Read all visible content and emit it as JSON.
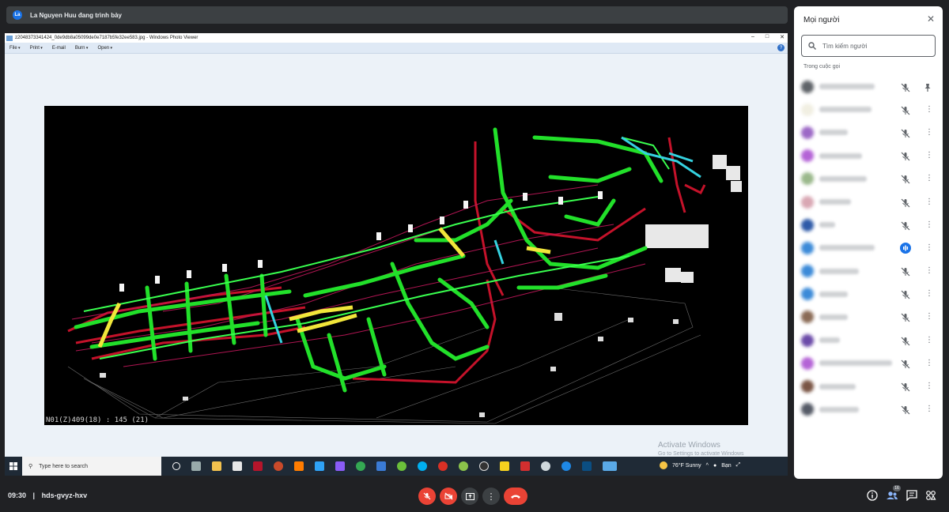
{
  "presenter": {
    "avatar": "La",
    "text": "La Nguyen Huu đang trình bày"
  },
  "shared_screen": {
    "window_title": "z2048373341424_0de9db8a05099de0e7187b5fe32ee583.jpg - Windows Photo Viewer",
    "menu": [
      "File",
      "Print",
      "E-mail",
      "Burn",
      "Open"
    ],
    "image_caption": "N01(Z)409(18) : 145 (21)",
    "activate_line1": "Activate Windows",
    "activate_line2": "Go to Settings to activate Windows",
    "taskbar_search": "Type here to search",
    "weather": "76°F  Sunny",
    "tray_label": "Bạn"
  },
  "panel": {
    "title": "Mọi người",
    "search_placeholder": "Tìm kiếm người",
    "section": "Trong cuộc gọi",
    "participants": [
      {
        "avatar_color": "#5f6368",
        "name_width": 70,
        "mic": "muted",
        "extra": "pin"
      },
      {
        "avatar_color": "#f1efe2",
        "name_width": 66,
        "mic": "muted"
      },
      {
        "avatar_color": "#9c68c6",
        "name_width": 36,
        "mic": "muted"
      },
      {
        "avatar_color": "#b463d6",
        "name_width": 54,
        "mic": "muted"
      },
      {
        "avatar_color": "#9ab88b",
        "name_width": 60,
        "mic": "muted"
      },
      {
        "avatar_color": "#d9a7b3",
        "name_width": 40,
        "mic": "muted"
      },
      {
        "avatar_color": "#2e5aa8",
        "name_width": 20,
        "mic": "muted"
      },
      {
        "avatar_color": "#3b8ad8",
        "name_width": 70,
        "mic": "speaking"
      },
      {
        "avatar_color": "#3b8ad8",
        "name_width": 50,
        "mic": "muted"
      },
      {
        "avatar_color": "#3b8ad8",
        "name_width": 36,
        "mic": "muted"
      },
      {
        "avatar_color": "#8a6a55",
        "name_width": 36,
        "mic": "muted"
      },
      {
        "avatar_color": "#6b4aa8",
        "name_width": 26,
        "mic": "muted"
      },
      {
        "avatar_color": "#b463d6",
        "name_width": 92,
        "mic": "muted"
      },
      {
        "avatar_color": "#7a5545",
        "name_width": 46,
        "mic": "muted"
      },
      {
        "avatar_color": "#555a66",
        "name_width": 50,
        "mic": "muted"
      }
    ]
  },
  "bottom": {
    "time": "09:30",
    "separator": "|",
    "meeting_code": "hds-gvyz-hxv",
    "people_count": "16"
  },
  "colors": {
    "accent": "#1a73e8",
    "danger": "#ea4335",
    "bg": "#202124"
  }
}
